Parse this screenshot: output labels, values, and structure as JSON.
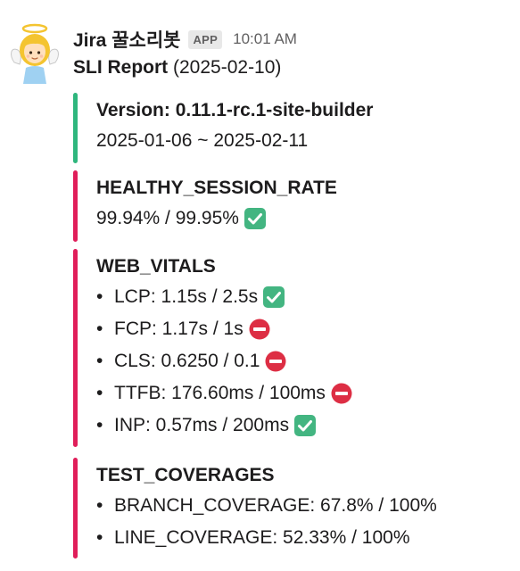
{
  "message": {
    "sender": "Jira 꿀소리봇",
    "badge": "APP",
    "time": "10:01 AM",
    "report_title_strong": "SLI Report",
    "report_title_date": " (2025-02-10)"
  },
  "colors": {
    "version_bar": "#2eb67d",
    "fail_bar": "#e01e5a",
    "check": "#43b581",
    "stop": "#dd2e44"
  },
  "sections": {
    "version": {
      "title": "Version: 0.11.1-rc.1-site-builder",
      "range": "2025-01-06 ~ 2025-02-11"
    },
    "healthy": {
      "title": "HEALTHY_SESSION_RATE",
      "value": "99.94% / 99.95%",
      "status_icon": "check-mark-icon"
    },
    "web_vitals": {
      "title": "WEB_VITALS",
      "items": [
        {
          "text": "LCP: 1.15s / 2.5s",
          "status_icon": "check-mark-icon"
        },
        {
          "text": "FCP: 1.17s / 1s",
          "status_icon": "no-entry-icon"
        },
        {
          "text": "CLS: 0.6250 / 0.1",
          "status_icon": "no-entry-icon"
        },
        {
          "text": "TTFB: 176.60ms / 100ms",
          "status_icon": "no-entry-icon"
        },
        {
          "text": "INP: 0.57ms / 200ms",
          "status_icon": "check-mark-icon"
        }
      ]
    },
    "test_coverages": {
      "title": "TEST_COVERAGES",
      "items": [
        {
          "text": "BRANCH_COVERAGE: 67.8% / 100%"
        },
        {
          "text": "LINE_COVERAGE: 52.33% / 100%"
        }
      ]
    }
  }
}
